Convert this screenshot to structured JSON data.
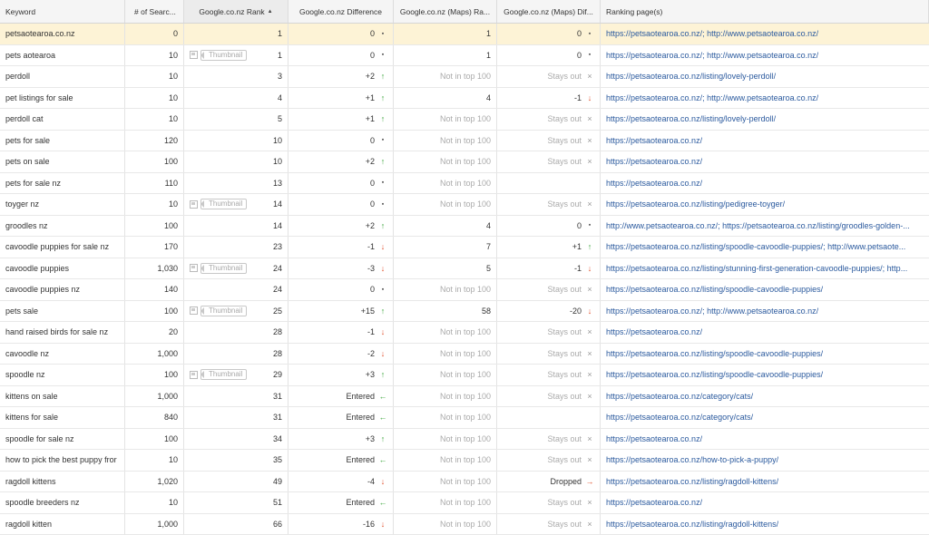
{
  "columns": {
    "keyword": "Keyword",
    "searches": "# of Searc...",
    "rank": "Google.co.nz Rank",
    "diff": "Google.co.nz Difference",
    "maps_rank": "Google.co.nz (Maps) Ra...",
    "maps_diff": "Google.co.nz (Maps) Dif...",
    "page": "Ranking page(s)"
  },
  "thumbnail_label": "Thumbnail",
  "rows": [
    {
      "kw": "petsaotearoa.co.nz",
      "srch": "0",
      "thumb": false,
      "rank": "1",
      "diff": "0",
      "di": "neutral",
      "mrank": "1",
      "mdiff": "0",
      "mi": "neutral",
      "page": "https://petsaotearoa.co.nz/; http://www.petsaotearoa.co.nz/"
    },
    {
      "kw": "pets aotearoa",
      "srch": "10",
      "thumb": true,
      "rank": "1",
      "diff": "0",
      "di": "neutral",
      "mrank": "1",
      "mdiff": "0",
      "mi": "neutral",
      "page": "https://petsaotearoa.co.nz/; http://www.petsaotearoa.co.nz/"
    },
    {
      "kw": "perdoll",
      "srch": "10",
      "thumb": false,
      "rank": "3",
      "diff": "+2",
      "di": "up",
      "mrank": "Not in top 100",
      "mdiff": "Stays out",
      "mi": "cross",
      "page": "https://petsaotearoa.co.nz/listing/lovely-perdoll/"
    },
    {
      "kw": "pet listings for sale",
      "srch": "10",
      "thumb": false,
      "rank": "4",
      "diff": "+1",
      "di": "up",
      "mrank": "4",
      "mdiff": "-1",
      "mi": "down",
      "page": "https://petsaotearoa.co.nz/; http://www.petsaotearoa.co.nz/"
    },
    {
      "kw": "perdoll cat",
      "srch": "10",
      "thumb": false,
      "rank": "5",
      "diff": "+1",
      "di": "up",
      "mrank": "Not in top 100",
      "mdiff": "Stays out",
      "mi": "cross",
      "page": "https://petsaotearoa.co.nz/listing/lovely-perdoll/"
    },
    {
      "kw": "pets for sale",
      "srch": "120",
      "thumb": false,
      "rank": "10",
      "diff": "0",
      "di": "neutral",
      "mrank": "Not in top 100",
      "mdiff": "Stays out",
      "mi": "cross",
      "page": "https://petsaotearoa.co.nz/"
    },
    {
      "kw": "pets on sale",
      "srch": "100",
      "thumb": false,
      "rank": "10",
      "diff": "+2",
      "di": "up",
      "mrank": "Not in top 100",
      "mdiff": "Stays out",
      "mi": "cross",
      "page": "https://petsaotearoa.co.nz/"
    },
    {
      "kw": "pets for sale nz",
      "srch": "110",
      "thumb": false,
      "rank": "13",
      "diff": "0",
      "di": "neutral",
      "mrank": "Not in top 100",
      "mdiff": "",
      "mi": "",
      "page": "https://petsaotearoa.co.nz/"
    },
    {
      "kw": "toyger nz",
      "srch": "10",
      "thumb": true,
      "rank": "14",
      "diff": "0",
      "di": "neutral",
      "mrank": "Not in top 100",
      "mdiff": "Stays out",
      "mi": "cross",
      "page": "https://petsaotearoa.co.nz/listing/pedigree-toyger/"
    },
    {
      "kw": "groodles nz",
      "srch": "100",
      "thumb": false,
      "rank": "14",
      "diff": "+2",
      "di": "up",
      "mrank": "4",
      "mdiff": "0",
      "mi": "neutral",
      "page": "http://www.petsaotearoa.co.nz/; https://petsaotearoa.co.nz/listing/groodles-golden-..."
    },
    {
      "kw": "cavoodle puppies for sale nz",
      "srch": "170",
      "thumb": false,
      "rank": "23",
      "diff": "-1",
      "di": "down",
      "mrank": "7",
      "mdiff": "+1",
      "mi": "up",
      "page": "https://petsaotearoa.co.nz/listing/spoodle-cavoodle-puppies/; http://www.petsaote..."
    },
    {
      "kw": "cavoodle puppies",
      "srch": "1,030",
      "thumb": true,
      "rank": "24",
      "diff": "-3",
      "di": "down",
      "mrank": "5",
      "mdiff": "-1",
      "mi": "down",
      "page": "https://petsaotearoa.co.nz/listing/stunning-first-generation-cavoodle-puppies/; http..."
    },
    {
      "kw": "cavoodle puppies nz",
      "srch": "140",
      "thumb": false,
      "rank": "24",
      "diff": "0",
      "di": "neutral",
      "mrank": "Not in top 100",
      "mdiff": "Stays out",
      "mi": "cross",
      "page": "https://petsaotearoa.co.nz/listing/spoodle-cavoodle-puppies/"
    },
    {
      "kw": "pets sale",
      "srch": "100",
      "thumb": true,
      "rank": "25",
      "diff": "+15",
      "di": "up",
      "mrank": "58",
      "mdiff": "-20",
      "mi": "down",
      "page": "https://petsaotearoa.co.nz/; http://www.petsaotearoa.co.nz/"
    },
    {
      "kw": "hand raised birds for sale nz",
      "srch": "20",
      "thumb": false,
      "rank": "28",
      "diff": "-1",
      "di": "down",
      "mrank": "Not in top 100",
      "mdiff": "Stays out",
      "mi": "cross",
      "page": "https://petsaotearoa.co.nz/"
    },
    {
      "kw": "cavoodle nz",
      "srch": "1,000",
      "thumb": false,
      "rank": "28",
      "diff": "-2",
      "di": "down",
      "mrank": "Not in top 100",
      "mdiff": "Stays out",
      "mi": "cross",
      "page": "https://petsaotearoa.co.nz/listing/spoodle-cavoodle-puppies/"
    },
    {
      "kw": "spoodle nz",
      "srch": "100",
      "thumb": true,
      "rank": "29",
      "diff": "+3",
      "di": "up",
      "mrank": "Not in top 100",
      "mdiff": "Stays out",
      "mi": "cross",
      "page": "https://petsaotearoa.co.nz/listing/spoodle-cavoodle-puppies/"
    },
    {
      "kw": "kittens on sale",
      "srch": "1,000",
      "thumb": false,
      "rank": "31",
      "diff": "Entered",
      "di": "entered",
      "mrank": "Not in top 100",
      "mdiff": "Stays out",
      "mi": "cross",
      "page": "https://petsaotearoa.co.nz/category/cats/"
    },
    {
      "kw": "kittens for sale",
      "srch": "840",
      "thumb": false,
      "rank": "31",
      "diff": "Entered",
      "di": "entered",
      "mrank": "Not in top 100",
      "mdiff": "",
      "mi": "",
      "page": "https://petsaotearoa.co.nz/category/cats/"
    },
    {
      "kw": "spoodle for sale nz",
      "srch": "100",
      "thumb": false,
      "rank": "34",
      "diff": "+3",
      "di": "up",
      "mrank": "Not in top 100",
      "mdiff": "Stays out",
      "mi": "cross",
      "page": "https://petsaotearoa.co.nz/"
    },
    {
      "kw": "how to pick the best puppy fror",
      "srch": "10",
      "thumb": false,
      "rank": "35",
      "diff": "Entered",
      "di": "entered",
      "mrank": "Not in top 100",
      "mdiff": "Stays out",
      "mi": "cross",
      "page": "https://petsaotearoa.co.nz/how-to-pick-a-puppy/"
    },
    {
      "kw": "ragdoll kittens",
      "srch": "1,020",
      "thumb": false,
      "rank": "49",
      "diff": "-4",
      "di": "down",
      "mrank": "Not in top 100",
      "mdiff": "Dropped",
      "mi": "dropped",
      "page": "https://petsaotearoa.co.nz/listing/ragdoll-kittens/"
    },
    {
      "kw": "spoodle breeders nz",
      "srch": "10",
      "thumb": false,
      "rank": "51",
      "diff": "Entered",
      "di": "entered",
      "mrank": "Not in top 100",
      "mdiff": "Stays out",
      "mi": "cross",
      "page": "https://petsaotearoa.co.nz/"
    },
    {
      "kw": "ragdoll kitten",
      "srch": "1,000",
      "thumb": false,
      "rank": "66",
      "diff": "-16",
      "di": "down",
      "mrank": "Not in top 100",
      "mdiff": "Stays out",
      "mi": "cross",
      "page": "https://petsaotearoa.co.nz/listing/ragdoll-kittens/"
    }
  ]
}
